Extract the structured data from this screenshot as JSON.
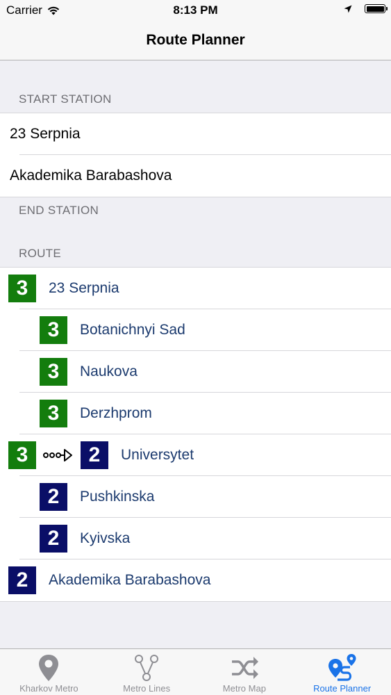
{
  "status_bar": {
    "carrier": "Carrier",
    "time": "8:13 PM"
  },
  "nav": {
    "title": "Route Planner"
  },
  "start": {
    "header": "START STATION",
    "stations": [
      "23 Serpnia",
      "Akademika Barabashova"
    ]
  },
  "end": {
    "header": "END STATION"
  },
  "route": {
    "header": "ROUTE",
    "steps": [
      {
        "line": "3",
        "name": "23 Serpnia"
      },
      {
        "line": "3",
        "name": "Botanichnyi Sad"
      },
      {
        "line": "3",
        "name": "Naukova"
      },
      {
        "line": "3",
        "name": "Derzhprom"
      },
      {
        "from_line": "3",
        "line": "2",
        "name": "Universytet"
      },
      {
        "line": "2",
        "name": "Pushkinska"
      },
      {
        "line": "2",
        "name": "Kyivska"
      },
      {
        "line": "2",
        "name": "Akademika Barabashova"
      }
    ]
  },
  "colors": {
    "line3": "#137d0d",
    "line2": "#0a0e67",
    "tab_active": "#1a73e8"
  },
  "tabs": [
    {
      "label": "Kharkov Metro",
      "icon": "location-pin-icon"
    },
    {
      "label": "Metro Lines",
      "icon": "metro-lines-icon"
    },
    {
      "label": "Metro Map",
      "icon": "shuffle-icon"
    },
    {
      "label": "Route Planner",
      "icon": "route-planner-icon",
      "active": true
    }
  ]
}
